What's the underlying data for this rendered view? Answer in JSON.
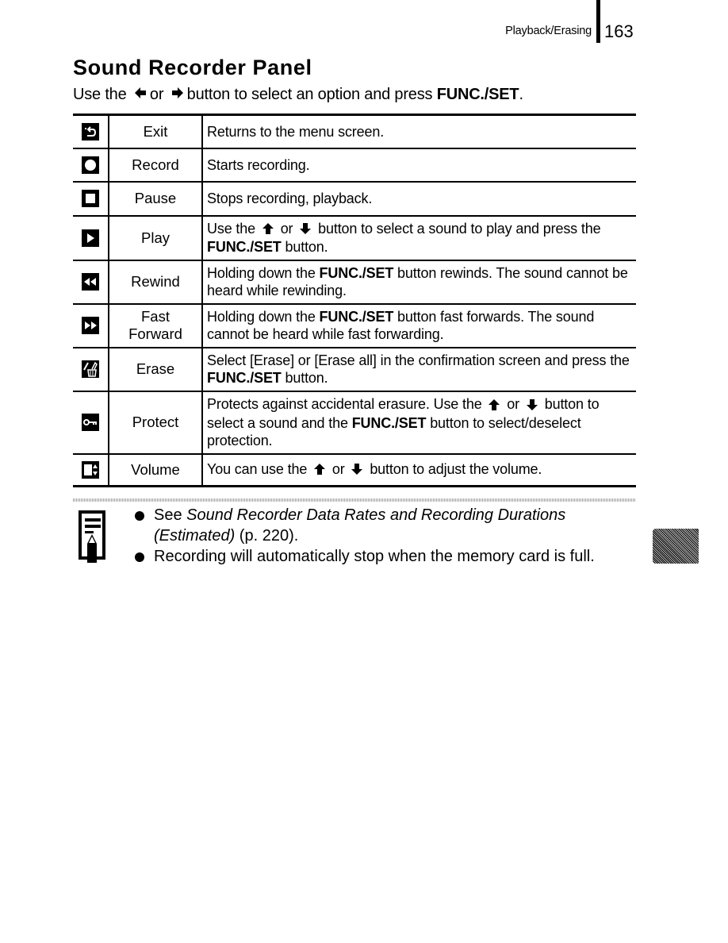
{
  "header": {
    "section": "Playback/Erasing",
    "page_number": "163"
  },
  "title": "Sound Recorder Panel",
  "intro": {
    "prefix": "Use the",
    "left_arrow_icon": "left-arrow-icon",
    "or": "or",
    "right_arrow_icon": "right-arrow-icon",
    "middle": "button to select an option and press",
    "button": "FUNC./SET",
    "suffix": "."
  },
  "table": {
    "rows": [
      {
        "icon": "exit-return-icon",
        "name": "Exit",
        "desc": [
          {
            "t": "Returns to the menu screen."
          }
        ]
      },
      {
        "icon": "record-circle-icon",
        "name": "Record",
        "desc": [
          {
            "t": "Starts recording."
          }
        ]
      },
      {
        "icon": "pause-stop-square-icon",
        "name": "Pause",
        "desc": [
          {
            "t": "Stops recording, playback."
          }
        ]
      },
      {
        "icon": "play-triangle-icon",
        "name": "Play",
        "desc": [
          {
            "t": "Use the "
          },
          {
            "arrow": "up"
          },
          {
            "t": " or "
          },
          {
            "arrow": "down"
          },
          {
            "t": " button to select a sound to play and press the "
          },
          {
            "b": "FUNC./SET"
          },
          {
            "t": " button."
          }
        ]
      },
      {
        "icon": "rewind-icon",
        "name": "Rewind",
        "desc": [
          {
            "t": "Holding down the "
          },
          {
            "b": "FUNC./SET"
          },
          {
            "t": " button rewinds. The sound cannot be heard while rewinding."
          }
        ]
      },
      {
        "icon": "fast-forward-icon",
        "name": "Fast Forward",
        "desc": [
          {
            "t": "Holding down the "
          },
          {
            "b": "FUNC./SET"
          },
          {
            "t": " button fast forwards. The sound cannot be heard while fast forwarding."
          }
        ]
      },
      {
        "icon": "erase-trash-icon",
        "name": "Erase",
        "desc": [
          {
            "t": "Select [Erase] or [Erase all] in the confirmation screen and press the "
          },
          {
            "b": "FUNC./SET"
          },
          {
            "t": " button."
          }
        ]
      },
      {
        "icon": "protect-key-icon",
        "name": "Protect",
        "desc": [
          {
            "t": "Protects against accidental erasure. Use the "
          },
          {
            "arrow": "up"
          },
          {
            "t": " or "
          },
          {
            "arrow": "down"
          },
          {
            "t": " button to select a sound and the "
          },
          {
            "b": "FUNC./SET"
          },
          {
            "t": " button to select/deselect protection."
          }
        ]
      },
      {
        "icon": "volume-icon",
        "name": "Volume",
        "desc": [
          {
            "t": "You can use the "
          },
          {
            "arrow": "up"
          },
          {
            "t": " or "
          },
          {
            "arrow": "down"
          },
          {
            "t": " button to adjust the volume."
          }
        ]
      }
    ]
  },
  "note": {
    "icon": "memo-pencil-icon",
    "items": [
      [
        {
          "t": "See "
        },
        {
          "i": "Sound Recorder Data Rates and Recording Durations (Estimated)"
        },
        {
          "t": " (p. 220)."
        }
      ],
      [
        {
          "t": "Recording will automatically stop when the memory card is full."
        }
      ]
    ]
  },
  "chapter_tab": {
    "color": "#555555"
  }
}
